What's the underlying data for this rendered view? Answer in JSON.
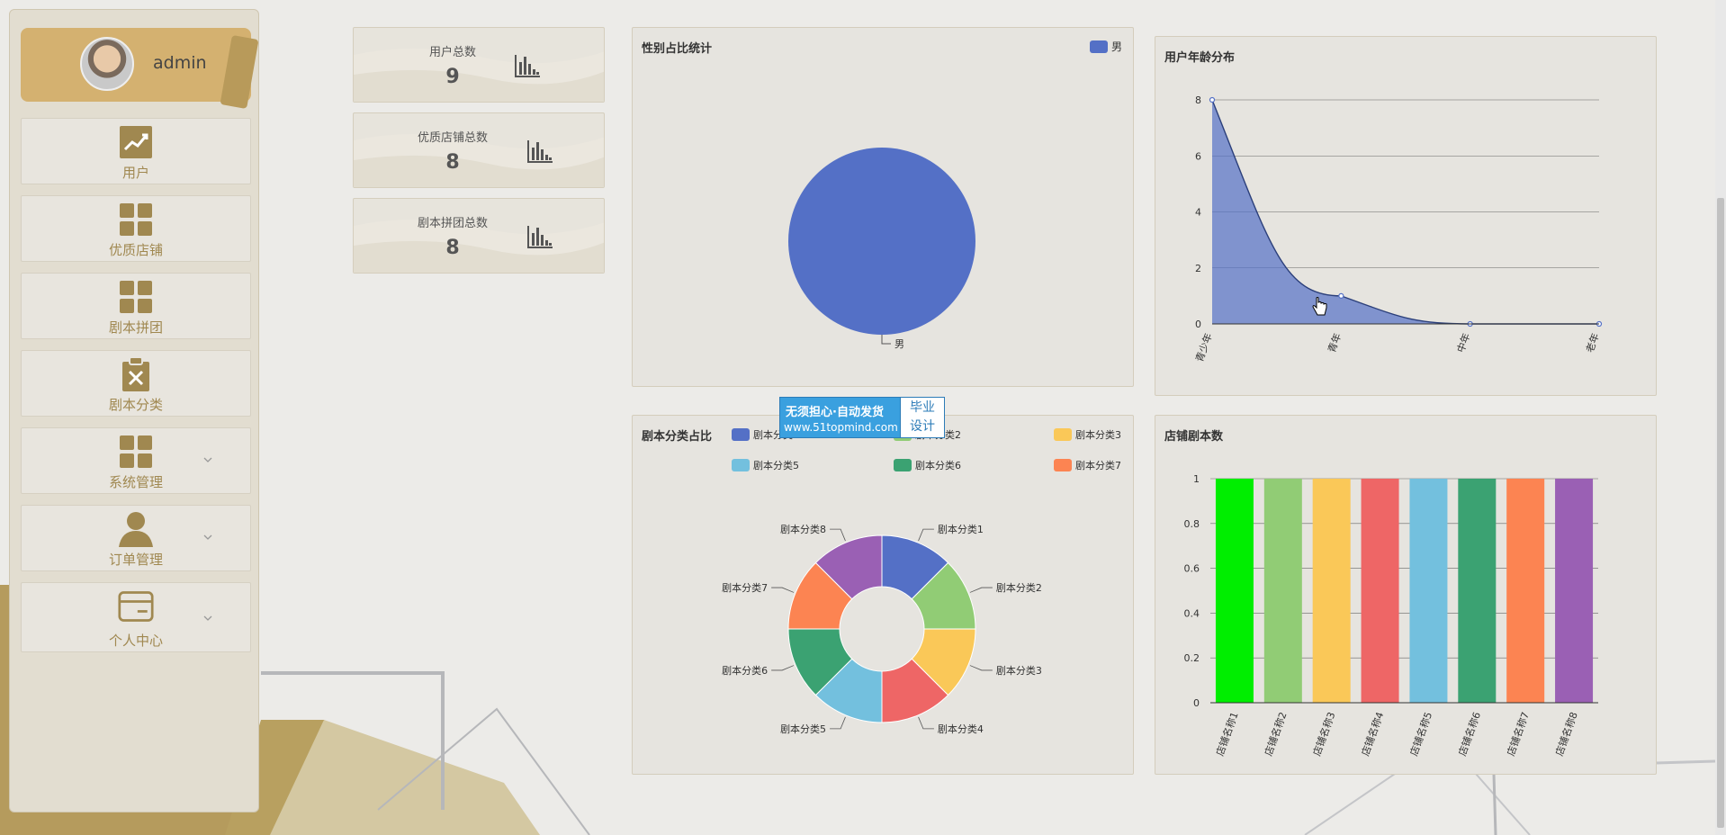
{
  "sidebar": {
    "username": "admin",
    "items": [
      {
        "label": "用户",
        "icon": "trend-chart-icon"
      },
      {
        "label": "优质店铺",
        "icon": "grid-icon"
      },
      {
        "label": "剧本拼团",
        "icon": "grid-icon"
      },
      {
        "label": "剧本分类",
        "icon": "clipboard-x-icon"
      },
      {
        "label": "系统管理",
        "icon": "grid-icon",
        "expandable": true
      },
      {
        "label": "订单管理",
        "icon": "user-icon",
        "expandable": true
      },
      {
        "label": "个人中心",
        "icon": "card-icon",
        "expandable": true
      }
    ]
  },
  "stats": [
    {
      "title": "用户总数",
      "value": "9"
    },
    {
      "title": "优质店铺总数",
      "value": "8"
    },
    {
      "title": "剧本拼团总数",
      "value": "8"
    }
  ],
  "watermark": {
    "line1": "无须担心·自动发货",
    "line2": "www.51topmind.com",
    "box1": "毕业",
    "box2": "设计"
  },
  "colors": {
    "blue": "#5470c6",
    "green": "#91cc75",
    "yellow": "#fac858",
    "red": "#ee6666",
    "cyan": "#73c0de",
    "teal": "#3ba272",
    "orange": "#fc8452",
    "purple": "#9a60b4",
    "brightGreen": "#00ee00",
    "accent": "#d4b170"
  },
  "chart_data": [
    {
      "type": "pie",
      "title": "性别占比统计",
      "legend": [
        "男"
      ],
      "legend_position": "top-right",
      "slices": [
        {
          "name": "男",
          "value": 1
        }
      ]
    },
    {
      "type": "area",
      "title": "用户年龄分布",
      "categories": [
        "青少年",
        "青年",
        "中年",
        "老年"
      ],
      "values": [
        8,
        1,
        0,
        0
      ],
      "ylim": [
        0,
        8
      ],
      "yticks": [
        0,
        2,
        4,
        6,
        8
      ],
      "grid": true,
      "smooth": true
    },
    {
      "type": "pie",
      "title": "剧本分类占比",
      "donut": true,
      "legend_position": "top-right",
      "slices": [
        {
          "name": "剧本分类1",
          "value": 1
        },
        {
          "name": "剧本分类2",
          "value": 1
        },
        {
          "name": "剧本分类3",
          "value": 1
        },
        {
          "name": "剧本分类4",
          "value": 1
        },
        {
          "name": "剧本分类5",
          "value": 1
        },
        {
          "name": "剧本分类6",
          "value": 1
        },
        {
          "name": "剧本分类7",
          "value": 1
        },
        {
          "name": "剧本分类8",
          "value": 1
        }
      ]
    },
    {
      "type": "bar",
      "title": "店铺剧本数",
      "categories": [
        "店铺名称1",
        "店铺名称2",
        "店铺名称3",
        "店铺名称4",
        "店铺名称5",
        "店铺名称6",
        "店铺名称7",
        "店铺名称8"
      ],
      "values": [
        1,
        1,
        1,
        1,
        1,
        1,
        1,
        1
      ],
      "ylim": [
        0,
        1
      ],
      "yticks": [
        "0",
        "0.2",
        "0.4",
        "0.6",
        "0.8",
        "1"
      ],
      "grid": true
    }
  ]
}
